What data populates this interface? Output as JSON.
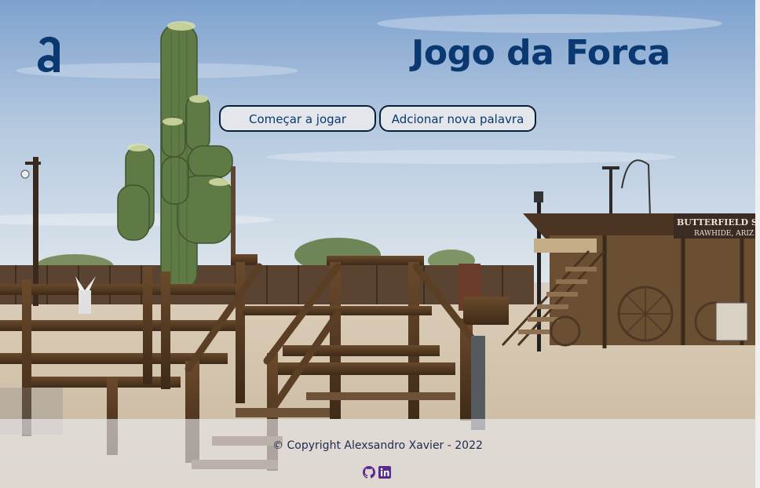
{
  "header": {
    "logo": "logo-icon",
    "title": "Jogo da Forca"
  },
  "actions": {
    "start_label": "Começar a jogar",
    "add_word_label": "Adcionar nova palavra"
  },
  "footer": {
    "copyright": "© Copyright Alexsandro Xavier - 2022",
    "links": [
      "github-icon",
      "linkedin-icon"
    ]
  },
  "signboard": {
    "line1": "BUTTERFIELD STA",
    "line2": "RAWHIDE, ARIZ"
  },
  "colors": {
    "title": "#0a3871",
    "button_border": "#0a1e3a",
    "button_bg": "#e3e6ea",
    "social_icons": "#5b2a8f"
  }
}
